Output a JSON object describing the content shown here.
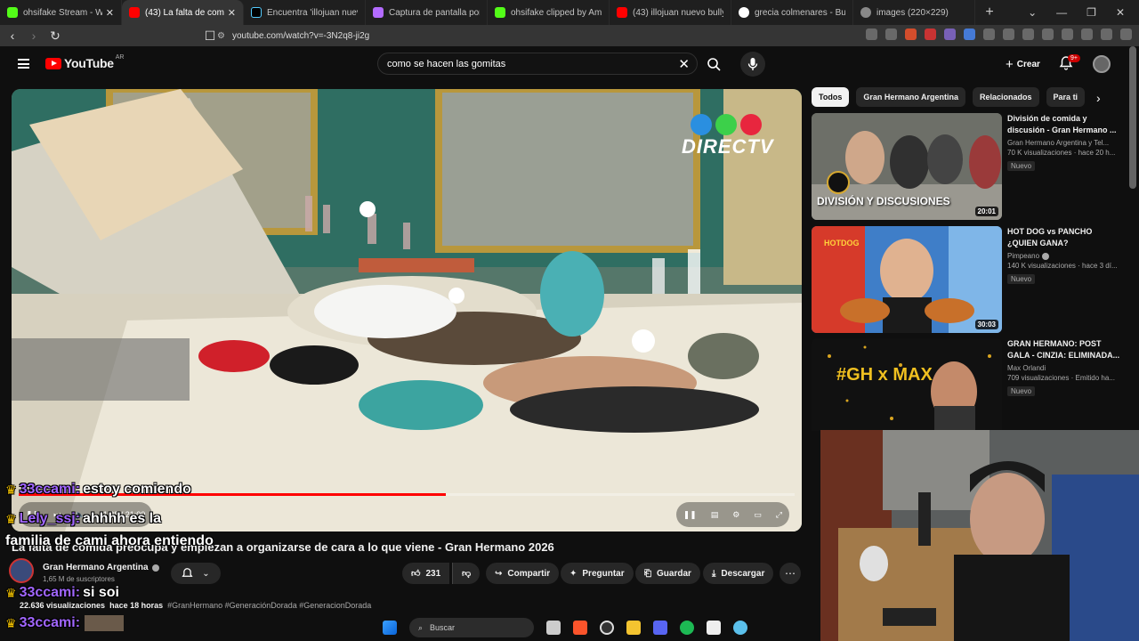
{
  "browser": {
    "tabs": [
      {
        "label": "ohsifake Stream - Watch L",
        "color": "#53fc18"
      },
      {
        "label": "(43) La falta de comida pr",
        "color": "#ff0000",
        "active": true
      },
      {
        "label": "Encuentra 'illojuan nuevo bully",
        "color": "#000000"
      },
      {
        "label": "Captura de pantalla por Lightshot",
        "color": "#b36bff"
      },
      {
        "label": "ohsifake clipped by AmirAbra",
        "color": "#53fc18"
      },
      {
        "label": "(43) illojuan nuevo bully - You",
        "color": "#ff0000"
      },
      {
        "label": "grecia colmenares - Buscar co",
        "color": "#4285f4"
      },
      {
        "label": "images (220×229)",
        "color": "#888888"
      }
    ],
    "url": "youtube.com/watch?v=-3N2q8-ji2g"
  },
  "header": {
    "logo": "YouTube",
    "country": "AR",
    "search_value": "como se hacen las gomitas",
    "create_label": "Crear",
    "notif_badge": "9+"
  },
  "video": {
    "overlay_logo": "DIRECTV",
    "time": "11:38 / 21:00",
    "progress": 0.55,
    "title": "La falta de comida preocupa y empiezan a organizarse de cara a lo que viene - Gran Hermano 2026",
    "channel": "Gran Hermano Argentina",
    "subscribers": "1,65 M de suscriptores",
    "likes": "231",
    "share": "Compartir",
    "ask": "Preguntar",
    "save": "Guardar",
    "download": "Descargar",
    "views": "22.636 visualizaciones",
    "age": "hace 18 horas",
    "tags": "#GranHermano #GeneraciónDorada #GeneracionDorada"
  },
  "chips": [
    "Todos",
    "Gran Hermano Argentina",
    "Relacionados",
    "Para ti"
  ],
  "recommendations": [
    {
      "title": "División de comida y discusión - Gran Hermano ...",
      "channel": "Gran Hermano Argentina y Tel...",
      "views": "70 K visualizaciones · hace 20 h...",
      "badge": "Nuevo",
      "duration": "20:01",
      "thumb_text": "DIVISIÓN Y DISCUSIONES"
    },
    {
      "title": "HOT DOG vs PANCHO ¿QUIEN GANA?",
      "channel": "Pimpeano",
      "views": "140 K visualizaciones · hace 3 dí...",
      "badge": "Nuevo",
      "duration": "30:03",
      "thumb_text": "HOTDOG"
    },
    {
      "title": "GRAN HERMANO: POST GALA - CINZIA: ELIMINADA...",
      "channel": "Max Orlandi",
      "views": "709 visualizaciones · Emitido ha...",
      "badge": "Nuevo",
      "duration": "",
      "thumb_text": "#GH x MAX"
    }
  ],
  "chat": [
    {
      "user": "33ccami:",
      "text": "estoy comiendo"
    },
    {
      "user": "Lely_ssj:",
      "text": "ahhhh es la"
    },
    {
      "user": "",
      "text": "familia de cami ahora entiendo"
    },
    {
      "user": "33ccami:",
      "text": "si soi"
    },
    {
      "user": "33ccami:",
      "text": ""
    }
  ],
  "taskbar": {
    "search_placeholder": "Buscar"
  }
}
